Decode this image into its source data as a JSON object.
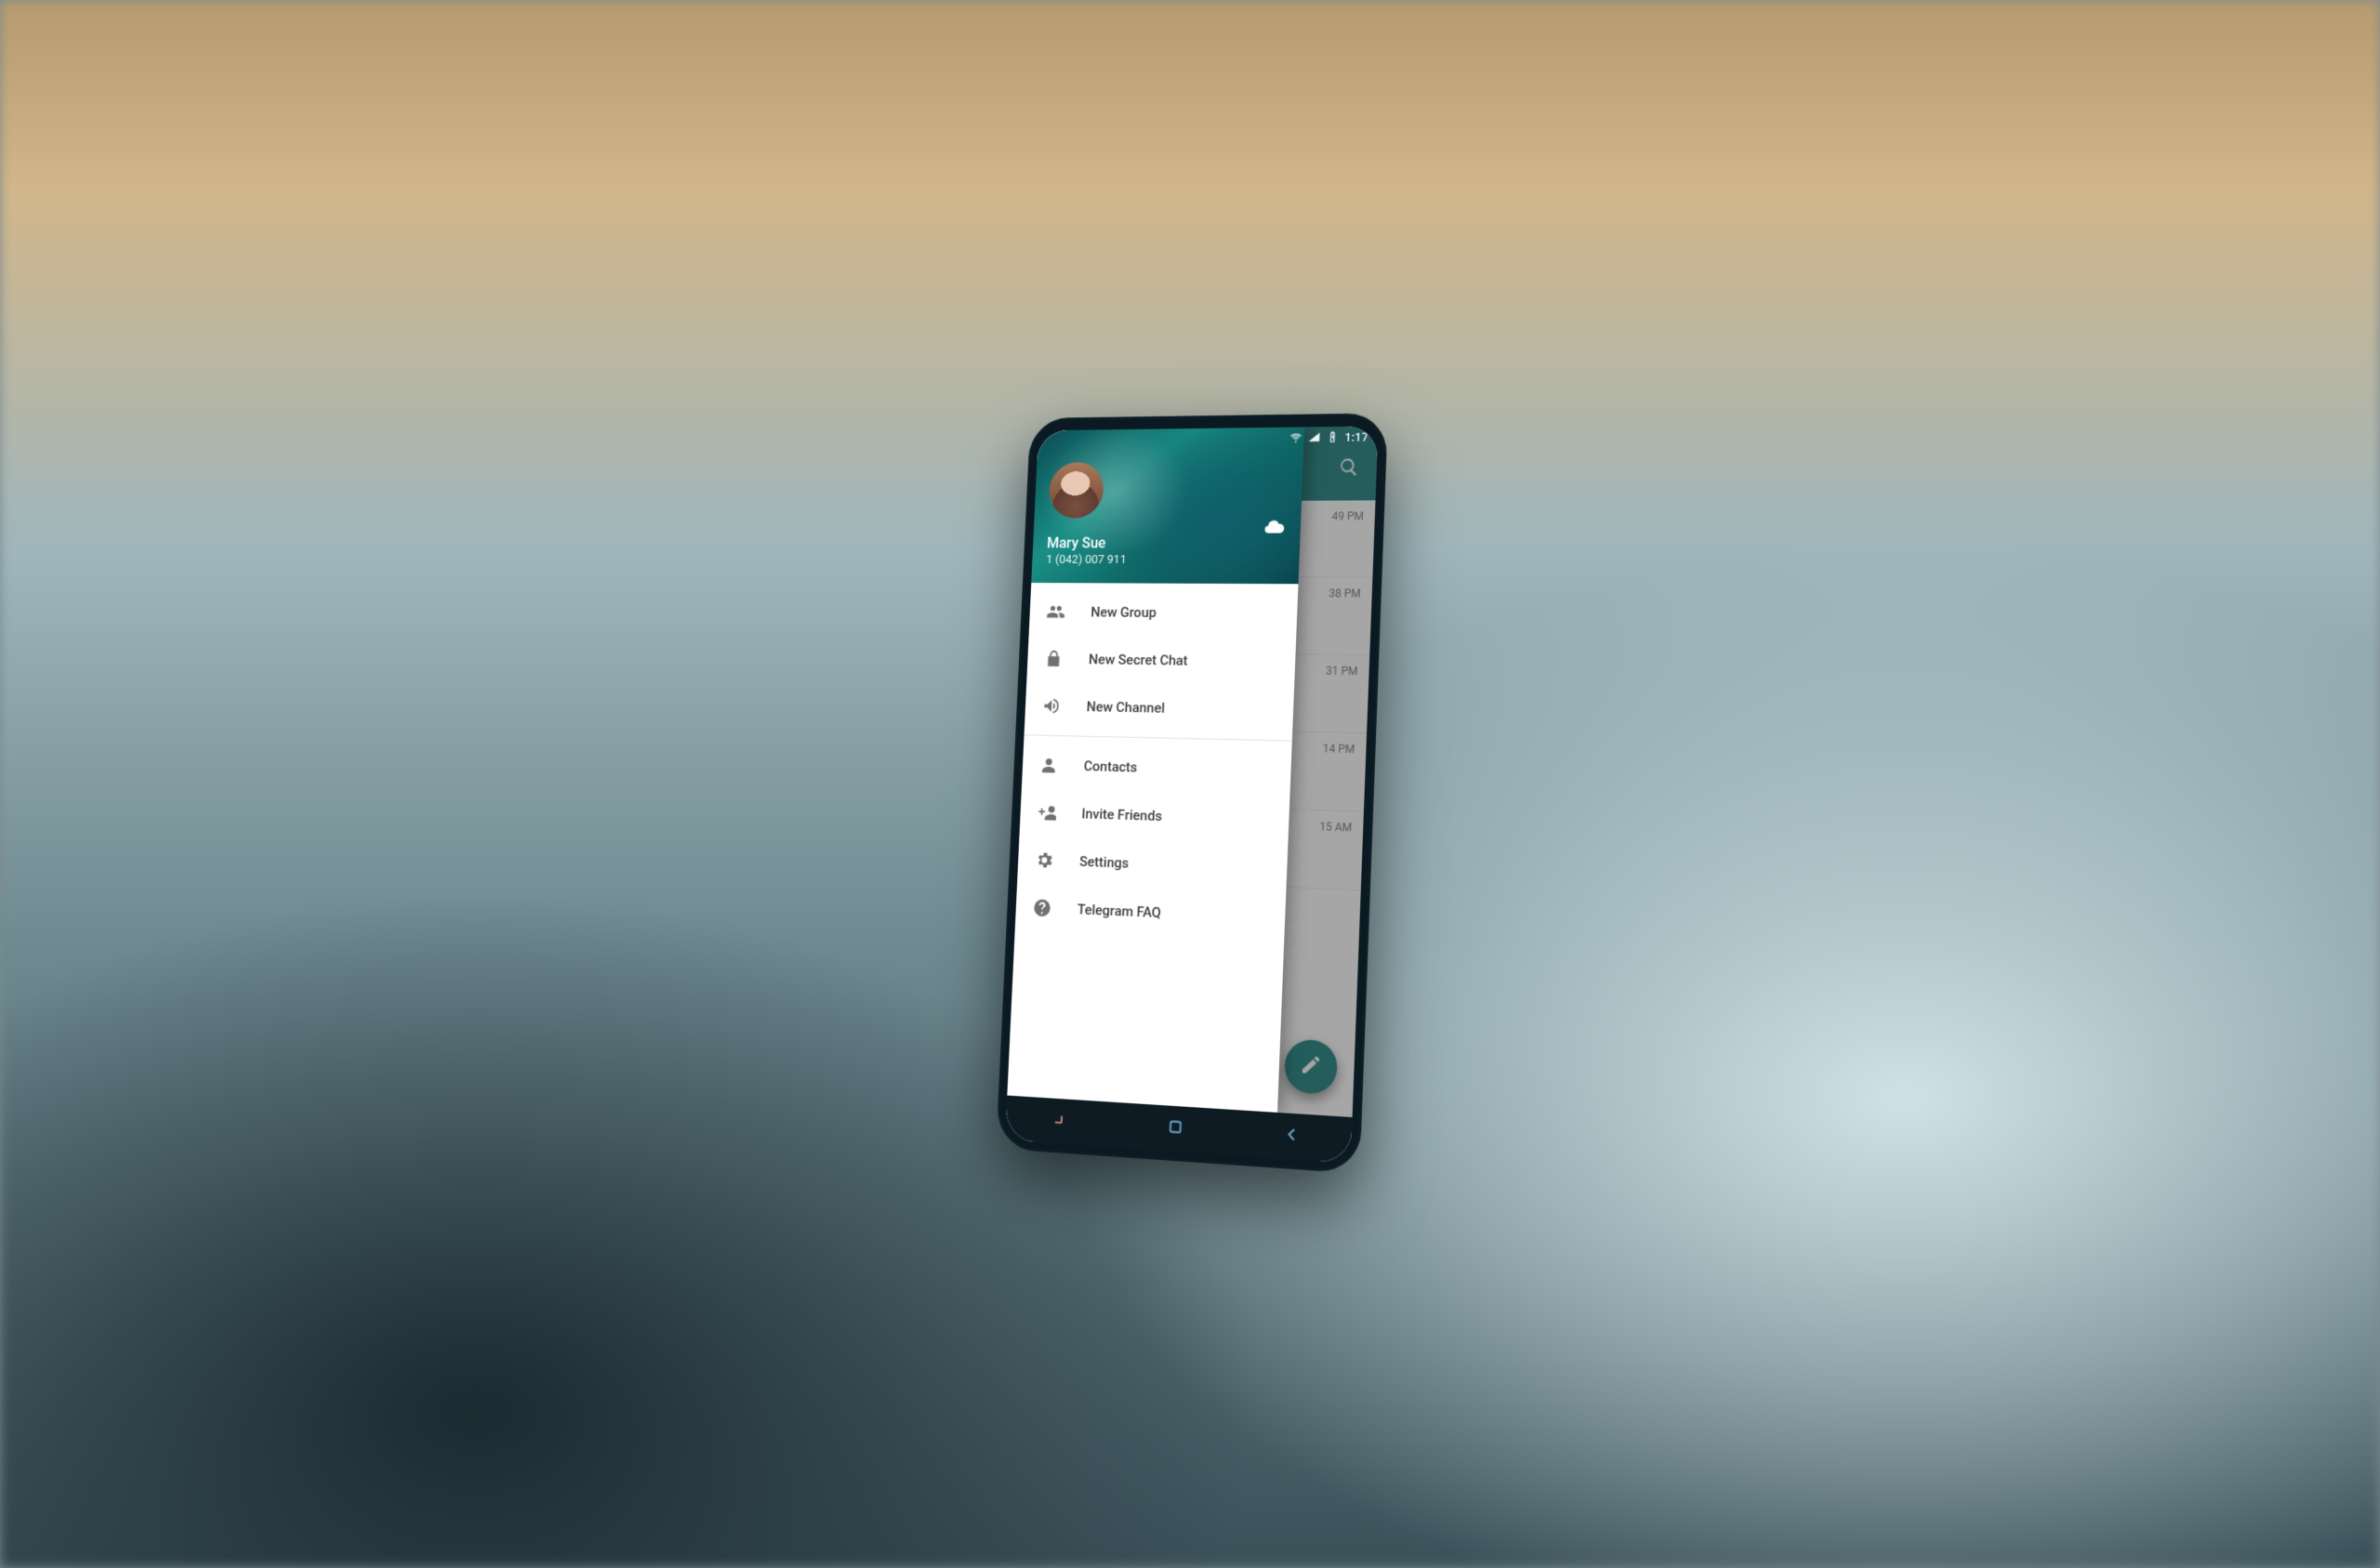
{
  "status": {
    "time": "1:17"
  },
  "profile": {
    "name": "Mary Sue",
    "phone": "1 (042) 007 911"
  },
  "drawer": {
    "section1": [
      {
        "icon": "group",
        "label": "New Group"
      },
      {
        "icon": "lock",
        "label": "New Secret Chat"
      },
      {
        "icon": "megaphone",
        "label": "New Channel"
      }
    ],
    "section2": [
      {
        "icon": "person",
        "label": "Contacts"
      },
      {
        "icon": "person-add",
        "label": "Invite Friends"
      },
      {
        "icon": "gear",
        "label": "Settings"
      },
      {
        "icon": "help",
        "label": "Telegram FAQ"
      }
    ]
  },
  "chat_times": [
    "49 PM",
    "38 PM",
    "31 PM",
    "14 PM",
    "15 AM"
  ]
}
